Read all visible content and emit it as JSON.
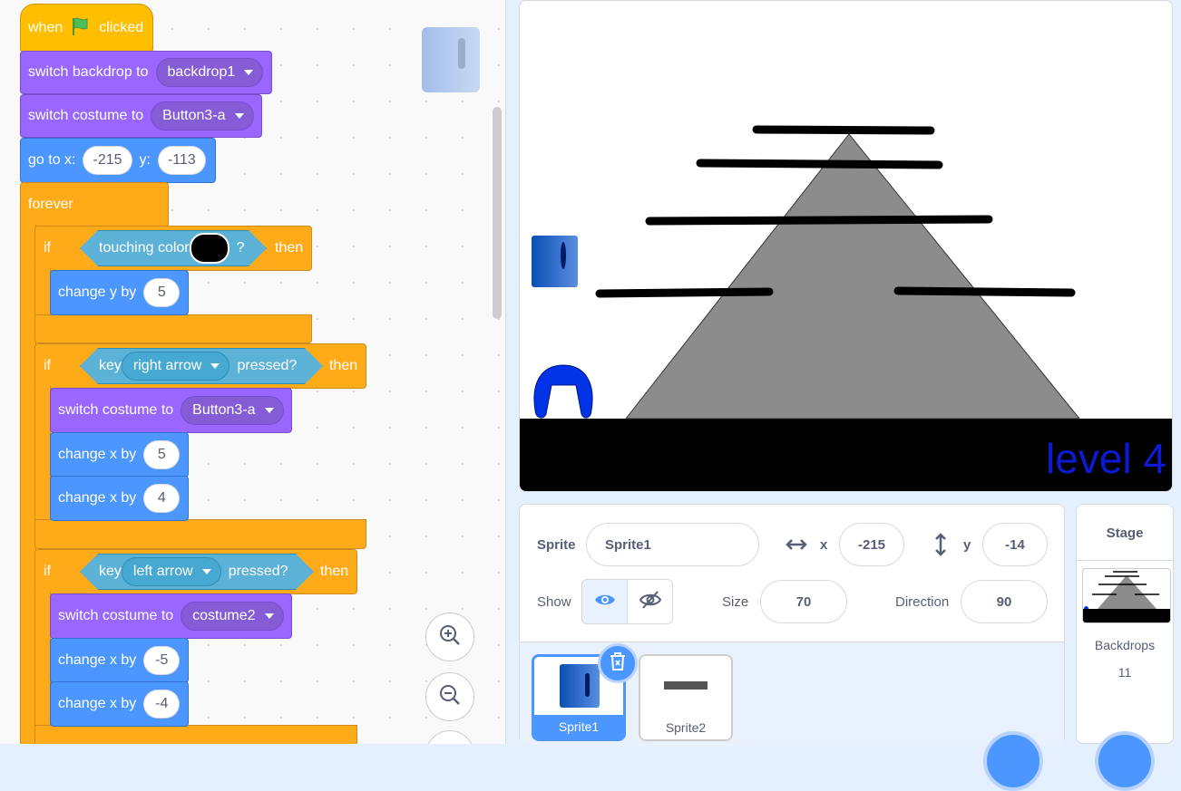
{
  "code": {
    "hat": {
      "when": "when",
      "clicked": "clicked"
    },
    "switch_backdrop": {
      "label": "switch backdrop to",
      "value": "backdrop1"
    },
    "switch_costume_1": {
      "label": "switch costume to",
      "value": "Button3-a"
    },
    "goto": {
      "label": "go to x:",
      "x": "-215",
      "ylabel": "y:",
      "y": "-113"
    },
    "forever": "forever",
    "if1": {
      "if": "if",
      "cond": "touching color",
      "q": "?",
      "then": "then"
    },
    "change_y": {
      "label": "change y by",
      "value": "5"
    },
    "if2": {
      "if": "if",
      "key": "key",
      "keyval": "right arrow",
      "pressed": "pressed?",
      "then": "then"
    },
    "switch_costume_2": {
      "label": "switch costume to",
      "value": "Button3-a"
    },
    "change_x_1": {
      "label": "change x by",
      "value": "5"
    },
    "change_x_2": {
      "label": "change x by",
      "value": "4"
    },
    "if3": {
      "if": "if",
      "key": "key",
      "keyval": "left arrow",
      "pressed": "pressed?",
      "then": "then"
    },
    "switch_costume_3": {
      "label": "switch costume to",
      "value": "costume2"
    },
    "change_x_3": {
      "label": "change x by",
      "value": "-5"
    },
    "change_x_4": {
      "label": "change x by",
      "value": "-4"
    }
  },
  "stage": {
    "level_text": "level 4"
  },
  "sprite_info": {
    "sprite_label": "Sprite",
    "sprite_name": "Sprite1",
    "x_label": "x",
    "x": "-215",
    "y_label": "y",
    "y": "-14",
    "show_label": "Show",
    "size_label": "Size",
    "size": "70",
    "direction_label": "Direction",
    "direction": "90"
  },
  "sprites": [
    {
      "name": "Sprite1"
    },
    {
      "name": "Sprite2"
    }
  ],
  "stage_panel": {
    "title": "Stage",
    "backdrops_label": "Backdrops",
    "backdrops_count": "11"
  },
  "colors": {
    "events": "#ffbf00",
    "looks": "#9966ff",
    "motion": "#4c97ff",
    "control": "#ffab19",
    "sensing": "#5cb1d6",
    "level_text": "#0d1ad3"
  }
}
